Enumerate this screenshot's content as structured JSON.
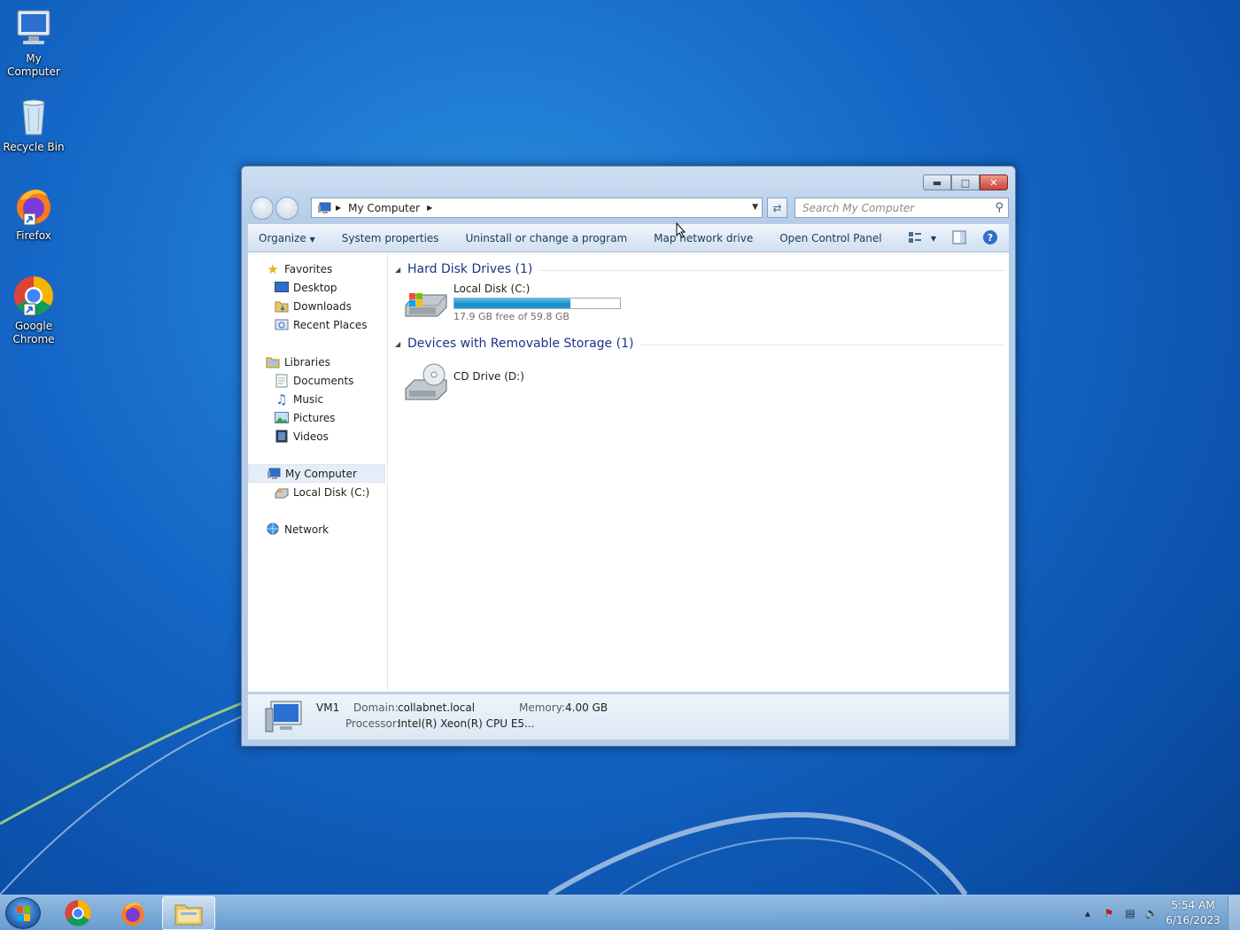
{
  "desktop": {
    "icons": [
      {
        "label": "My\nComputer",
        "line1": "My",
        "line2": "Computer",
        "icon": "computer-icon"
      },
      {
        "label": "Recycle Bin",
        "icon": "recycle-bin-icon"
      },
      {
        "label": "Firefox",
        "icon": "firefox-icon"
      },
      {
        "label": "Google Chrome",
        "line1": "Google",
        "line2": "Chrome",
        "icon": "chrome-icon"
      }
    ]
  },
  "window": {
    "address": {
      "location": "My Computer"
    },
    "search": {
      "placeholder": "Search My Computer"
    },
    "toolbar": {
      "organize": "Organize",
      "system_properties": "System properties",
      "uninstall": "Uninstall or change a program",
      "map_drive": "Map network drive",
      "control_panel": "Open Control Panel"
    },
    "nav": {
      "favorites": "Favorites",
      "desktop": "Desktop",
      "downloads": "Downloads",
      "recent_places": "Recent Places",
      "libraries": "Libraries",
      "documents": "Documents",
      "music": "Music",
      "pictures": "Pictures",
      "videos": "Videos",
      "my_computer": "My Computer",
      "local_disk": "Local Disk (C:)",
      "network": "Network"
    },
    "groups": {
      "hard_disks": "Hard Disk Drives (1)",
      "removable": "Devices with Removable Storage (1)"
    },
    "drives": {
      "local": {
        "name": "Local Disk (C:)",
        "free_text": "17.9 GB free of 59.8 GB",
        "used_fraction": 0.7
      },
      "cd": {
        "name": "CD Drive (D:)"
      }
    },
    "details": {
      "computer_name": "VM1",
      "domain_label": "Domain:",
      "domain_value": "collabnet.local",
      "memory_label": "Memory:",
      "memory_value": "4.00 GB",
      "processor_label": "Processor:",
      "processor_value": "Intel(R) Xeon(R) CPU E5..."
    }
  },
  "taskbar": {
    "time": "5:54 AM",
    "date": "6/16/2023",
    "apps": [
      "chrome-icon",
      "firefox-icon",
      "explorer-icon"
    ]
  },
  "colors": {
    "accent": "#1e3287",
    "desktop": "#1466c6",
    "bar_fill": "#1d8cc8"
  }
}
